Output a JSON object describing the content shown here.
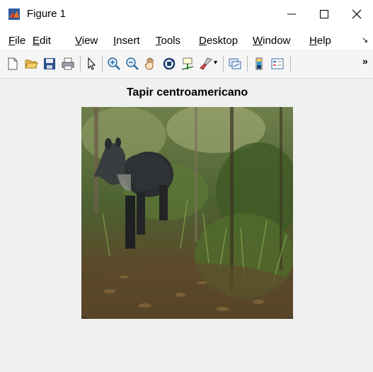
{
  "window": {
    "title": "Figure 1"
  },
  "menu": [
    {
      "accel": "F",
      "rest": "ile"
    },
    {
      "accel": "E",
      "rest": "dit"
    },
    {
      "accel": "V",
      "rest": "iew"
    },
    {
      "accel": "I",
      "rest": "nsert"
    },
    {
      "accel": "T",
      "rest": "ools"
    },
    {
      "accel": "D",
      "rest": "esktop"
    },
    {
      "accel": "W",
      "rest": "indow"
    },
    {
      "accel": "H",
      "rest": "elp"
    }
  ],
  "toolbar": {
    "icons": [
      "new-figure-icon",
      "open-file-icon",
      "save-icon",
      "print-icon",
      "select-pointer-icon",
      "zoom-in-icon",
      "zoom-out-icon",
      "pan-hand-icon",
      "rotate-3d-icon",
      "data-cursor-icon",
      "brush-icon",
      "link-plot-icon",
      "colorbar-icon",
      "legend-icon"
    ]
  },
  "axes": {
    "title": "Tapir centroamericano",
    "image_subject": "tapir-photo"
  },
  "colors": {
    "titlebar": "#ffffff",
    "background": "#f0f0f0",
    "accent": "#d9534f"
  }
}
